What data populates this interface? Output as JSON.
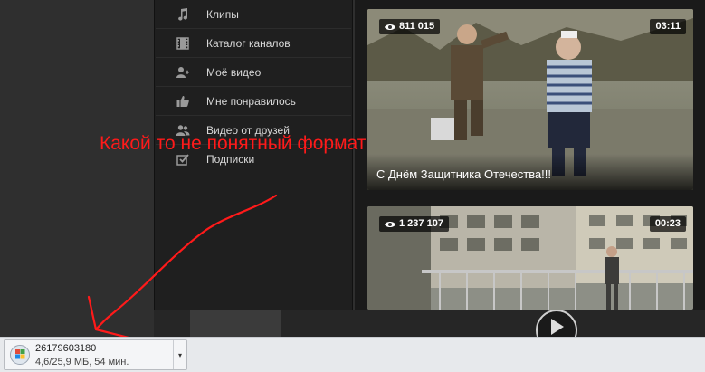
{
  "menu": {
    "items": [
      {
        "label": "Клипы",
        "icon": "music-note-icon"
      },
      {
        "label": "Каталог каналов",
        "icon": "film-icon"
      },
      {
        "label": "Моё видео",
        "icon": "user-add-icon"
      },
      {
        "label": "Мне понравилось",
        "icon": "thumbs-up-icon"
      },
      {
        "label": "Видео от друзей",
        "icon": "friends-icon"
      },
      {
        "label": "Подписки",
        "icon": "checkbox-icon"
      }
    ]
  },
  "videos": [
    {
      "views": "811 015",
      "duration": "03:11",
      "title": "С Днём Защитника Отечества!!!"
    },
    {
      "views": "1 237 107",
      "duration": "00:23",
      "title": ""
    }
  ],
  "annotation": {
    "text": "Какой то не понятный формат",
    "color": "#ff1a1a"
  },
  "download": {
    "filename": "26179603180",
    "status": "4,6/25,9 МБ, 54 мин."
  }
}
